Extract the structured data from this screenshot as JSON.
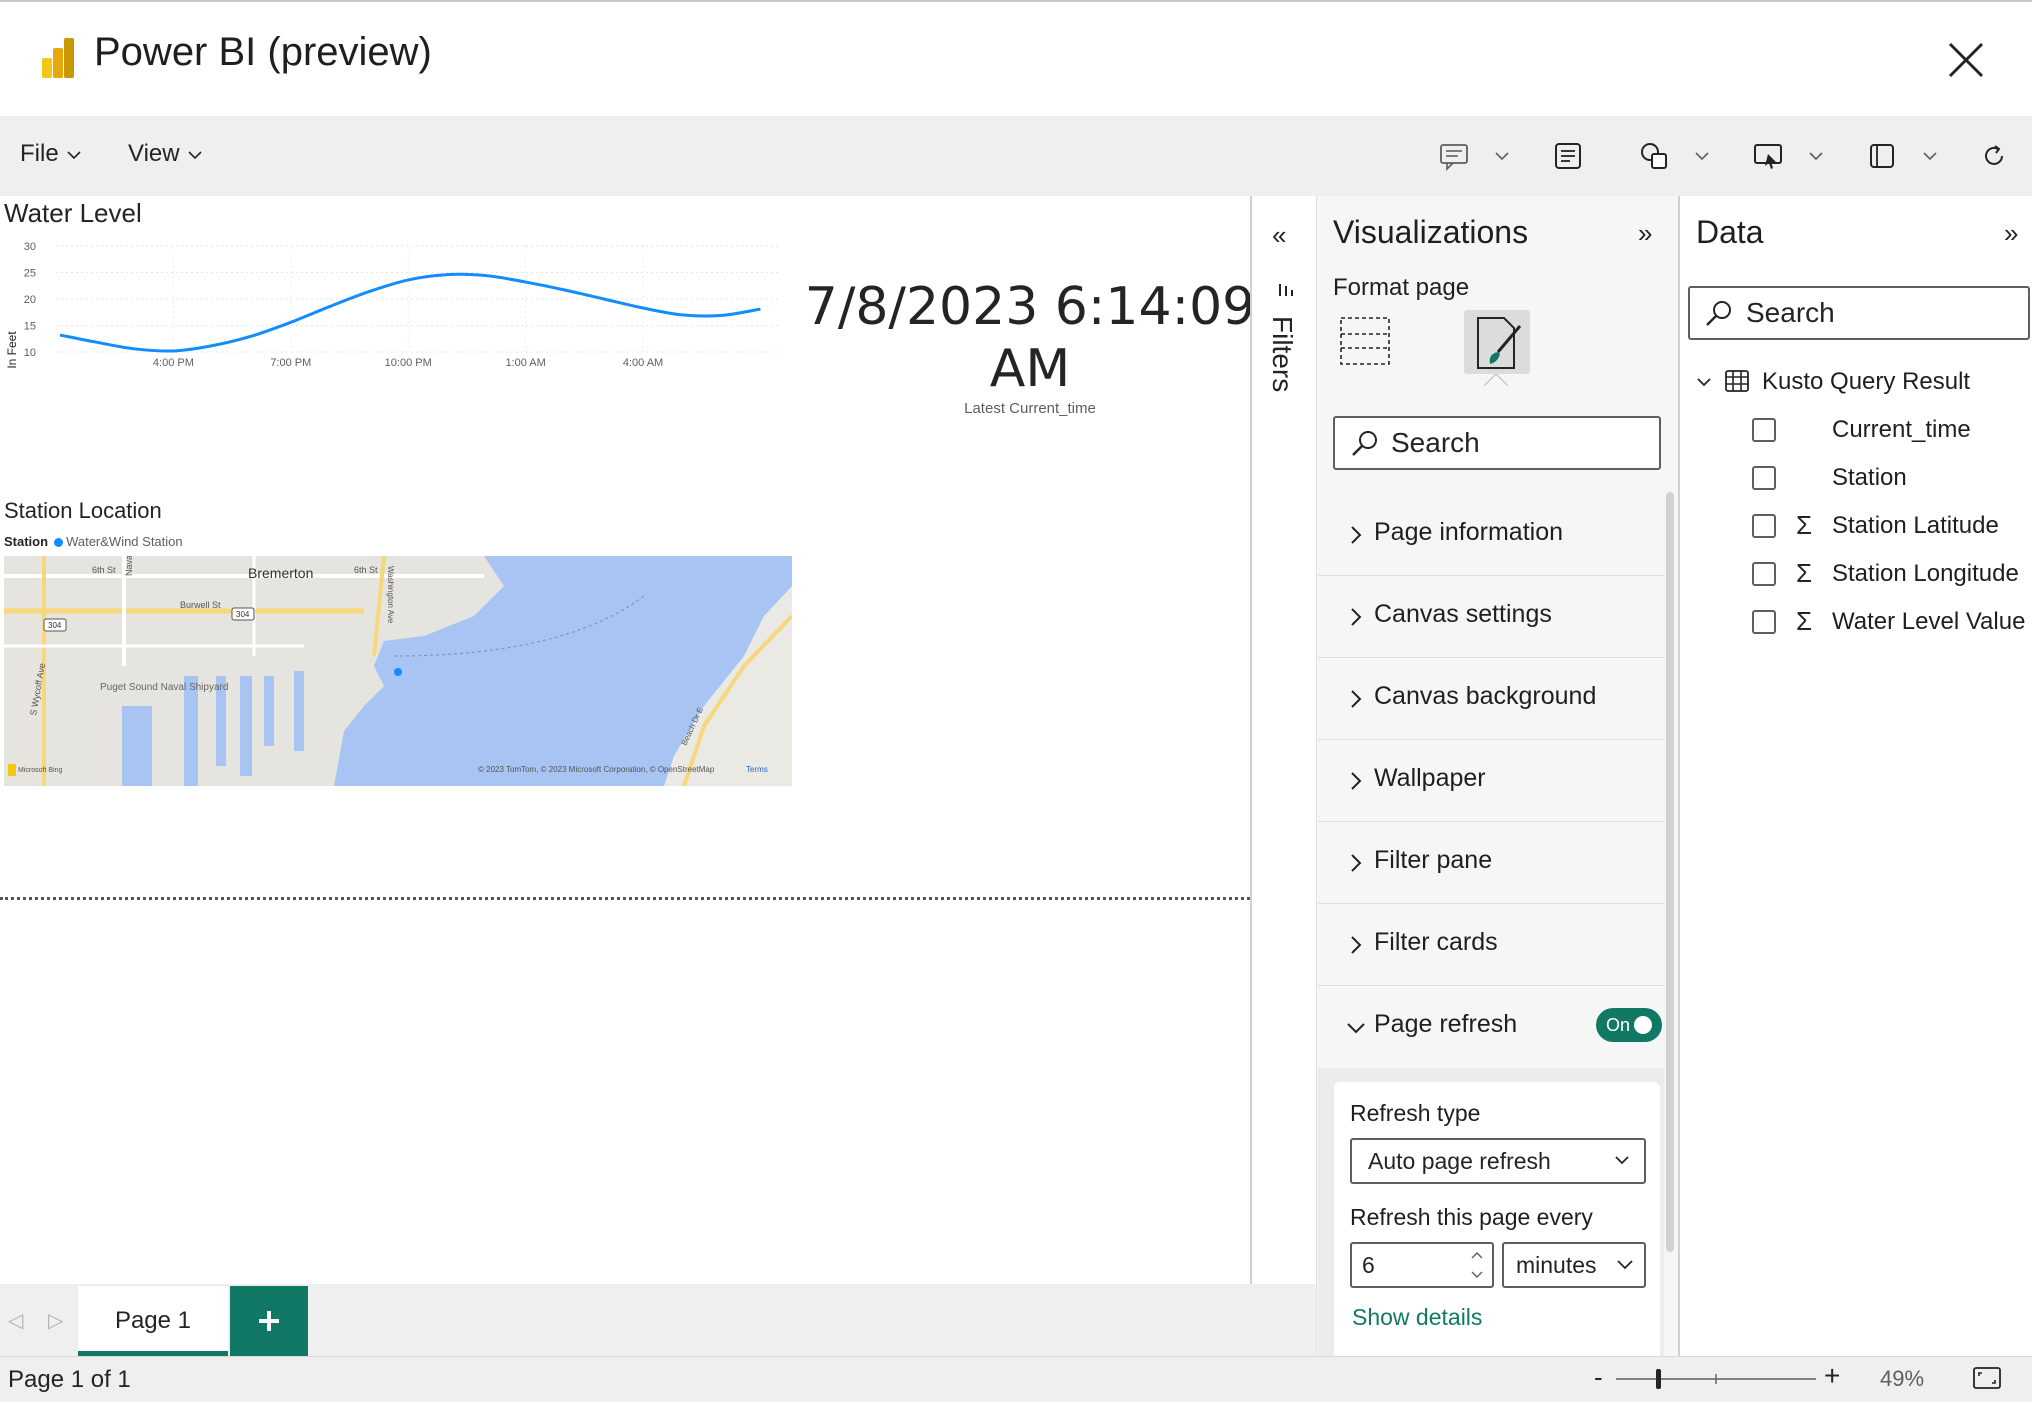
{
  "app": {
    "title": "Power BI (preview)"
  },
  "menu": {
    "file": "File",
    "view": "View"
  },
  "toolbar": {
    "icons": [
      "comment-icon",
      "note-icon",
      "shapes-icon",
      "present-icon",
      "layout-icon",
      "refresh-icon"
    ]
  },
  "canvas": {
    "water_level": {
      "title": "Water Level",
      "ylabel": "In Feet",
      "yticks": [
        "30",
        "25",
        "20",
        "15",
        "10"
      ],
      "xticks": [
        "4:00 PM",
        "7:00 PM",
        "10:00 PM",
        "1:00 AM",
        "4:00 AM"
      ]
    },
    "card": {
      "value_line1": "7/8/2023 6:14:09",
      "value_line2": "AM",
      "label": "Latest Current_time"
    },
    "station_location": {
      "title": "Station Location",
      "legend_title": "Station",
      "legend_item": "Water&Wind Station",
      "map_labels": {
        "city": "Bremerton",
        "street1": "6th St",
        "street2": "6th St",
        "burwell": "Burwell St",
        "route1": "304",
        "route2": "304",
        "naval": "Naval Ave",
        "wycoff": "S Wycoff Ave",
        "washington": "Washington Ave",
        "shipyard": "Puget Sound Naval Shipyard",
        "beach": "Beach Dr E",
        "credit": "© 2023 TomTom, © 2023 Microsoft Corporation, © OpenStreetMap",
        "terms": "Terms",
        "brand": "Microsoft Bing"
      }
    }
  },
  "chart_data": {
    "type": "line",
    "title": "Water Level",
    "xlabel": "",
    "ylabel": "In Feet",
    "x_ticks": [
      "4:00 PM",
      "7:00 PM",
      "10:00 PM",
      "1:00 AM",
      "4:00 AM"
    ],
    "ylim": [
      10,
      30
    ],
    "grid": true,
    "series": [
      {
        "x_hours_from_4pm": [
          -2.9,
          -2.0,
          -1.0,
          0.0,
          1.0,
          2.0,
          3.0,
          4.0,
          5.0,
          6.0,
          7.0,
          8.0,
          9.0,
          10.0,
          11.0,
          12.0,
          13.0,
          14.0,
          15.0
        ],
        "values": [
          13.2,
          11.9,
          10.6,
          10.2,
          11.2,
          13.0,
          15.6,
          18.6,
          21.4,
          23.6,
          24.6,
          24.4,
          23.2,
          21.7,
          20.0,
          18.3,
          17.0,
          16.9,
          18.1
        ]
      }
    ]
  },
  "filters": {
    "label": "Filters"
  },
  "visualizations": {
    "title": "Visualizations",
    "format_label": "Format page",
    "search_placeholder": "Search",
    "sections": [
      "Page information",
      "Canvas settings",
      "Canvas background",
      "Wallpaper",
      "Filter pane",
      "Filter cards"
    ],
    "page_refresh": {
      "label": "Page refresh",
      "toggle": "On",
      "refresh_type_label": "Refresh type",
      "refresh_type_value": "Auto page refresh",
      "refresh_every_label": "Refresh this page every",
      "interval_value": "6",
      "interval_unit": "minutes",
      "show_details": "Show details"
    },
    "accent_color": "#117865"
  },
  "data": {
    "title": "Data",
    "search_placeholder": "Search",
    "table": "Kusto Query Result",
    "fields": [
      {
        "name": "Current_time",
        "sigma": ""
      },
      {
        "name": "Station",
        "sigma": ""
      },
      {
        "name": "Station Latitude",
        "sigma": "Σ"
      },
      {
        "name": "Station Longitude",
        "sigma": "Σ"
      },
      {
        "name": "Water Level Value",
        "sigma": "Σ"
      }
    ]
  },
  "tabs": {
    "page1": "Page 1"
  },
  "status": {
    "page_count": "Page 1 of 1",
    "zoom": "49%"
  }
}
